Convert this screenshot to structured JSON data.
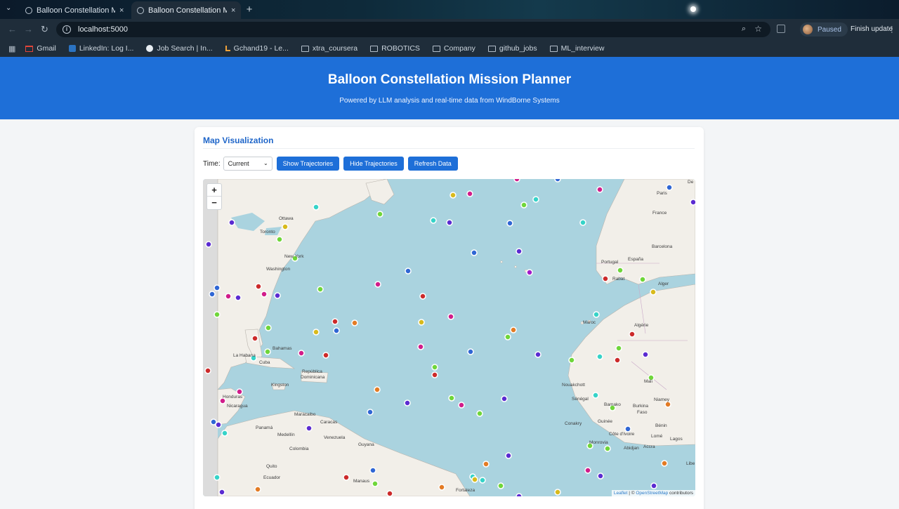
{
  "browser": {
    "tabs": [
      {
        "title": "Balloon Constellation Mi",
        "close": "×"
      },
      {
        "title": "Balloon Constellation Mi",
        "close": "×"
      }
    ],
    "new_tab": "+",
    "url": "localhost:5000",
    "profile_status": "Paused",
    "finish_update": "Finish update",
    "bookmarks": [
      {
        "label": "Gmail",
        "icon": "gmail-icon"
      },
      {
        "label": "LinkedIn: Log I...",
        "icon": "linkedin-icon"
      },
      {
        "label": "Job Search | In...",
        "icon": "info-icon"
      },
      {
        "label": "Gchand19 - Le...",
        "icon": "leetcode-icon"
      },
      {
        "label": "xtra_coursera",
        "icon": "folder-icon"
      },
      {
        "label": "ROBOTICS",
        "icon": "folder-icon"
      },
      {
        "label": "Company",
        "icon": "folder-icon"
      },
      {
        "label": "github_jobs",
        "icon": "folder-icon"
      },
      {
        "label": "ML_interview",
        "icon": "folder-icon"
      }
    ]
  },
  "header": {
    "title": "Balloon Constellation Mission Planner",
    "subtitle": "Powered by LLM analysis and real-time data from WindBorne Systems"
  },
  "card": {
    "title": "Map Visualization",
    "time_label": "Time:",
    "time_selected": "Current",
    "buttons": {
      "show": "Show Trajectories",
      "hide": "Hide Trajectories",
      "refresh": "Refresh Data"
    }
  },
  "map": {
    "zoom_in": "+",
    "zoom_out": "−",
    "attribution": {
      "leaflet": "Leaflet",
      "sep": " | © ",
      "osm": "OpenStreetMap",
      "tail": " contributors"
    },
    "labels": {
      "ottawa": "Ottawa",
      "toronto": "Toronto",
      "newyork": "New York",
      "washington": "Washington",
      "bahamas": "Bahamas",
      "lahabana": "La Habana",
      "cuba": "Cuba",
      "kingston": "Kingston",
      "republica": "República",
      "dominicana": "Dominicana",
      "honduras": "Honduras",
      "nicaragua": "Nicaragua",
      "panama": "Panamá",
      "maracaibo": "Maracaibo",
      "caracas": "Caracas",
      "medellin": "Medellín",
      "venezuela": "Venezuela",
      "guyana": "Guyana",
      "colombia": "Colombia",
      "quito": "Quito",
      "ecuador": "Ecuador",
      "manaus": "Manaus",
      "fortaleza": "Fortaleza",
      "paris": "Paris",
      "france": "France",
      "barcelona": "Barcelona",
      "espana": "España",
      "portugal": "Portugal",
      "rabat": "Rabat",
      "alger": "Alger",
      "maroc": "Maroc",
      "algerie": "Algérie",
      "mali": "Mali",
      "niamey": "Niamey",
      "nouakchott": "Nouakchott",
      "senegal": "Sénégal",
      "bamako": "Bamako",
      "burkina": "Burkina",
      "faso": "Faso",
      "conakry": "Conakry",
      "guinee": "Guinée",
      "benin": "Bénin",
      "cotedivoire": "Côte d'Ivoire",
      "lome": "Lomé",
      "lagos": "Lagos",
      "abidjan": "Abidjan",
      "accra": "Accra",
      "monrovia": "Monrovia",
      "libe": "Libe",
      "de": "De"
    },
    "balloon_colors": [
      "#5b2bd1",
      "#d11c8a",
      "#2f66d4",
      "#36d3c8",
      "#6fd63a",
      "#d8ba1c",
      "#cc2a2a",
      "#e37b24",
      "#a21cc9",
      "#e0275a"
    ]
  }
}
